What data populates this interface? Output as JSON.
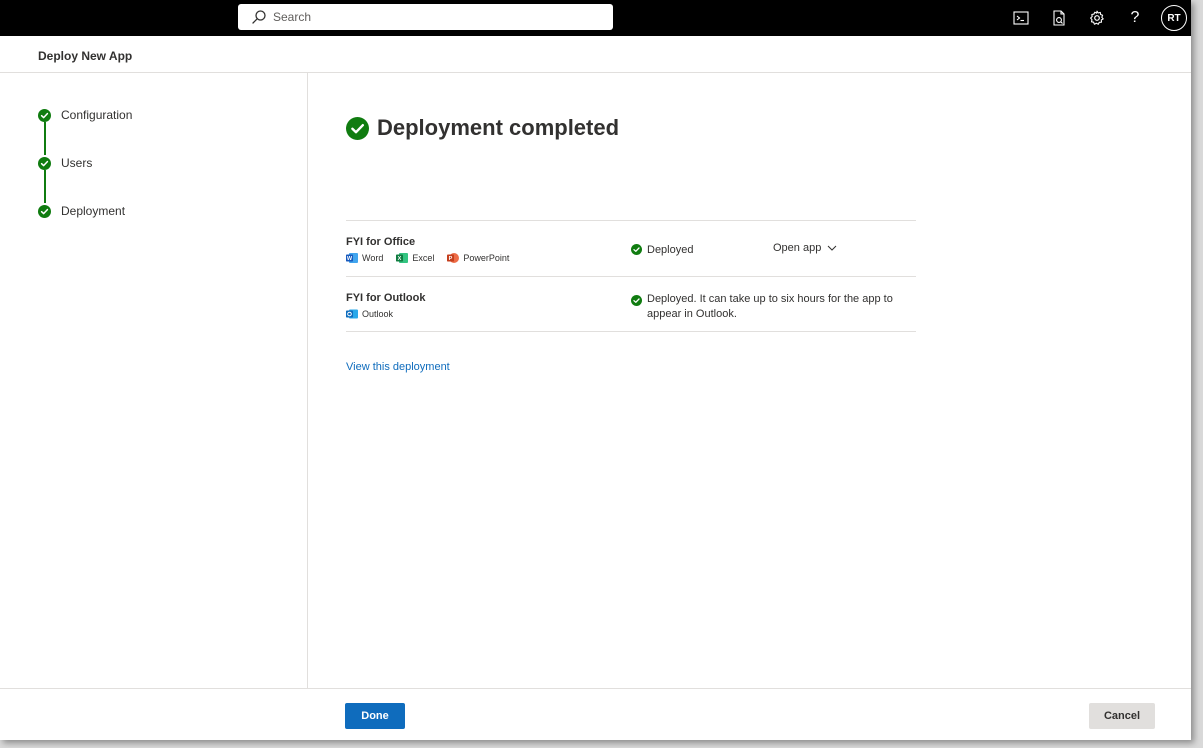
{
  "topbar": {
    "search": {
      "placeholder": "Search",
      "value": ""
    },
    "icons": [
      "cloud-shell-icon",
      "feedback-icon",
      "gear-icon",
      "help-icon"
    ],
    "avatar_initials": "RT"
  },
  "header": {
    "title": "Deploy New App"
  },
  "steps": [
    {
      "label": "Configuration",
      "status": "completed"
    },
    {
      "label": "Users",
      "status": "completed"
    },
    {
      "label": "Deployment",
      "status": "completed"
    }
  ],
  "main": {
    "title": "Deployment completed",
    "apps": [
      {
        "name": "FYI for Office",
        "hosts": [
          {
            "label": "Word",
            "icon": "word-icon"
          },
          {
            "label": "Excel",
            "icon": "excel-icon"
          },
          {
            "label": "PowerPoint",
            "icon": "powerpoint-icon"
          }
        ],
        "status": "Deployed",
        "action_label": "Open app"
      },
      {
        "name": "FYI for Outlook",
        "hosts": [
          {
            "label": "Outlook",
            "icon": "outlook-icon"
          }
        ],
        "status": "Deployed. It can take up to six hours for the app to appear in Outlook."
      }
    ],
    "view_link": "View this deployment"
  },
  "footer": {
    "done_label": "Done",
    "cancel_label": "Cancel"
  },
  "colors": {
    "accent": "#0f6cbd",
    "success": "#107c10",
    "word": "#185abd",
    "excel": "#107c41",
    "powerpoint": "#c43e1c",
    "outlook": "#0f6cbd"
  }
}
